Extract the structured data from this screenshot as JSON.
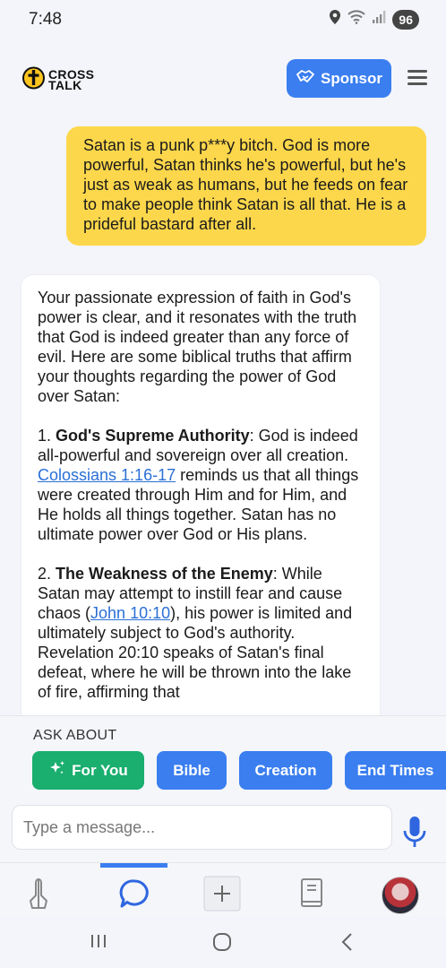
{
  "status_bar": {
    "time": "7:48",
    "battery": "96"
  },
  "header": {
    "logo_line1": "CROSS",
    "logo_line2": "TALK",
    "sponsor_label": "Sponsor"
  },
  "chat": {
    "user_message": "Satan is a punk p***y bitch. God is more powerful, Satan thinks he's powerful, but he's just as weak as humans, but he feeds on fear to make people think Satan is all that. He is a prideful bastard after all.",
    "bot_intro": "Your passionate expression of faith in God's power is clear, and it resonates with the truth that God is indeed greater than any force of evil. Here are some biblical truths that affirm your thoughts regarding the power of God over Satan:",
    "point1": {
      "number": "1.",
      "title": "God's Supreme Authority",
      "text_before": ": God is indeed all-powerful and sovereign over all creation.",
      "link": "Colossians 1:16-17",
      "text_after": "reminds us that all things were created through Him and for Him, and He holds all things together. Satan has no ultimate power over God or His plans."
    },
    "point2": {
      "number": "2.",
      "title": "The Weakness of the Enemy",
      "text_before": ": While Satan may attempt to instill fear and cause chaos (",
      "link": "John 10:10",
      "text_after": "), his power is limited and ultimately subject to God's authority. Revelation 20:10 speaks of Satan's final defeat, where he will be thrown into the lake of fire, affirming that"
    }
  },
  "ask_about": {
    "label": "ASK ABOUT",
    "chips": [
      "For You",
      "Bible",
      "Creation",
      "End Times"
    ]
  },
  "input": {
    "placeholder": "Type a message..."
  },
  "colors": {
    "primary": "#3a7ef0",
    "green": "#1aae6f",
    "user_bubble": "#fdd74b"
  }
}
